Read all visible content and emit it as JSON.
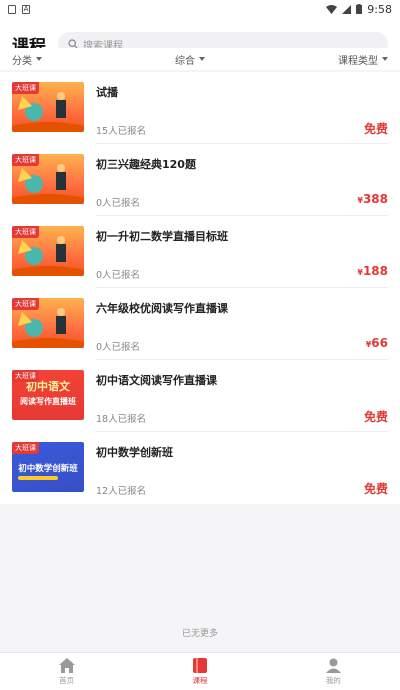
{
  "status_bar": {
    "time": "9:58"
  },
  "header": {
    "title": "课程",
    "search_placeholder": "搜索课程"
  },
  "filters": [
    {
      "label": "分类"
    },
    {
      "label": "综合"
    },
    {
      "label": "课程类型"
    }
  ],
  "tag_label": "大班课",
  "courses": [
    {
      "title": "试播",
      "enrolled": "15人已报名",
      "price": "免费",
      "price_symbol": "",
      "thumb": "illustration"
    },
    {
      "title": "初三兴趣经典120题",
      "enrolled": "0人已报名",
      "price": "388",
      "price_symbol": "¥",
      "thumb": "illustration"
    },
    {
      "title": "初一升初二数学直播目标班",
      "enrolled": "0人已报名",
      "price": "188",
      "price_symbol": "¥",
      "thumb": "illustration"
    },
    {
      "title": "六年级校优阅读写作直播课",
      "enrolled": "0人已报名",
      "price": "66",
      "price_symbol": "¥",
      "thumb": "illustration"
    },
    {
      "title": "初中语文阅读写作直播课",
      "enrolled": "18人已报名",
      "price": "免费",
      "price_symbol": "",
      "thumb": "red-text",
      "thumb_text_1": "初中语文",
      "thumb_text_2": "阅读写作直播班"
    },
    {
      "title": "初中数学创新班",
      "enrolled": "12人已报名",
      "price": "免费",
      "price_symbol": "",
      "thumb": "blue-text",
      "thumb_text_1": "初中数学创新班"
    }
  ],
  "no_more": "已无更多",
  "tabbar": [
    {
      "label": "首页",
      "icon": "home-icon",
      "active": false
    },
    {
      "label": "课程",
      "icon": "book-icon",
      "active": true
    },
    {
      "label": "我的",
      "icon": "user-icon",
      "active": false
    }
  ],
  "colors": {
    "accent": "#e53935",
    "background": "#f5f5f7"
  }
}
